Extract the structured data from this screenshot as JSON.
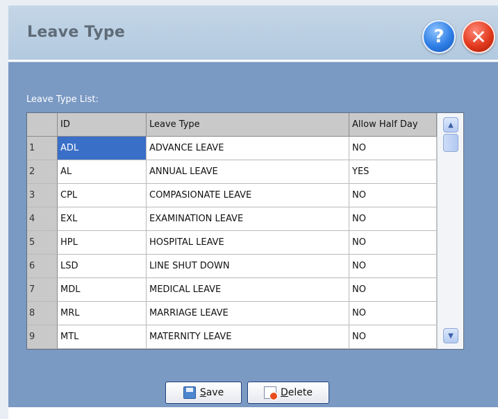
{
  "window": {
    "title": "Leave Type"
  },
  "header_buttons": {
    "help_icon": "question-mark-circle",
    "help_glyph": "?",
    "close_icon": "close-x-circle",
    "close_glyph": "✕"
  },
  "list_label": "Leave Type List:",
  "grid": {
    "columns": [
      "ID",
      "Leave Type",
      "Allow Half Day"
    ],
    "rows": [
      {
        "num": "1",
        "id": "ADL",
        "type": "ADVANCE LEAVE",
        "half": "NO"
      },
      {
        "num": "2",
        "id": "AL",
        "type": "ANNUAL LEAVE",
        "half": "YES"
      },
      {
        "num": "3",
        "id": "CPL",
        "type": "COMPASIONATE LEAVE",
        "half": "NO"
      },
      {
        "num": "4",
        "id": "EXL",
        "type": "EXAMINATION LEAVE",
        "half": "NO"
      },
      {
        "num": "5",
        "id": "HPL",
        "type": "HOSPITAL LEAVE",
        "half": "NO"
      },
      {
        "num": "6",
        "id": "LSD",
        "type": "LINE SHUT DOWN",
        "half": "NO"
      },
      {
        "num": "7",
        "id": "MDL",
        "type": "MEDICAL LEAVE",
        "half": "NO"
      },
      {
        "num": "8",
        "id": "MRL",
        "type": "MARRIAGE LEAVE",
        "half": "NO"
      },
      {
        "num": "9",
        "id": "MTL",
        "type": "MATERNITY LEAVE",
        "half": "NO"
      }
    ],
    "selected_row": 1
  },
  "buttons": {
    "save": {
      "mnemonic": "S",
      "rest": "ave",
      "icon": "floppy-disk"
    },
    "delete": {
      "mnemonic": "D",
      "rest": "elete",
      "icon": "delete-document"
    }
  },
  "colors": {
    "panel": "#7a99c3",
    "header": "#b8cde2",
    "selected": "#3a6fc8"
  }
}
